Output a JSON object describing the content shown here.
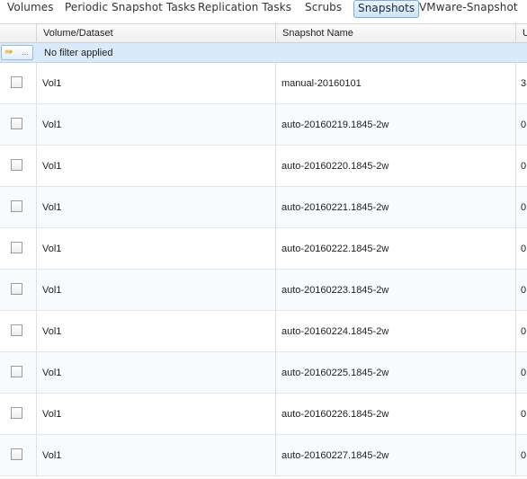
{
  "tabs": [
    {
      "label": "Volumes"
    },
    {
      "label": "Periodic Snapshot Tasks"
    },
    {
      "label": "Replication Tasks"
    },
    {
      "label": "Scrubs"
    },
    {
      "label": "Snapshots"
    },
    {
      "label": "VMware-Snapshot"
    }
  ],
  "active_tab": "Snapshots",
  "grid": {
    "columns": [
      "Volume/Dataset",
      "Snapshot Name",
      "U"
    ],
    "filter_button": "...",
    "filter_text": "No filter applied",
    "rows": [
      {
        "volume": "Vol1",
        "snapshot": "manual-20160101",
        "used": "3"
      },
      {
        "volume": "Vol1",
        "snapshot": "auto-20160219.1845-2w",
        "used": "0"
      },
      {
        "volume": "Vol1",
        "snapshot": "auto-20160220.1845-2w",
        "used": "0"
      },
      {
        "volume": "Vol1",
        "snapshot": "auto-20160221.1845-2w",
        "used": "0"
      },
      {
        "volume": "Vol1",
        "snapshot": "auto-20160222.1845-2w",
        "used": "0"
      },
      {
        "volume": "Vol1",
        "snapshot": "auto-20160223.1845-2w",
        "used": "0"
      },
      {
        "volume": "Vol1",
        "snapshot": "auto-20160224.1845-2w",
        "used": "0"
      },
      {
        "volume": "Vol1",
        "snapshot": "auto-20160225.1845-2w",
        "used": "0"
      },
      {
        "volume": "Vol1",
        "snapshot": "auto-20160226.1845-2w",
        "used": "0"
      },
      {
        "volume": "Vol1",
        "snapshot": "auto-20160227.1845-2w",
        "used": "0"
      }
    ]
  },
  "colors": {
    "active_tab_border": "#7eadd9",
    "filter_bar": "#d9ebfa",
    "row_alt": "#f7fbfe"
  },
  "icons": {
    "filter": "filter-arrow-icon",
    "checkbox": "checkbox-icon"
  }
}
